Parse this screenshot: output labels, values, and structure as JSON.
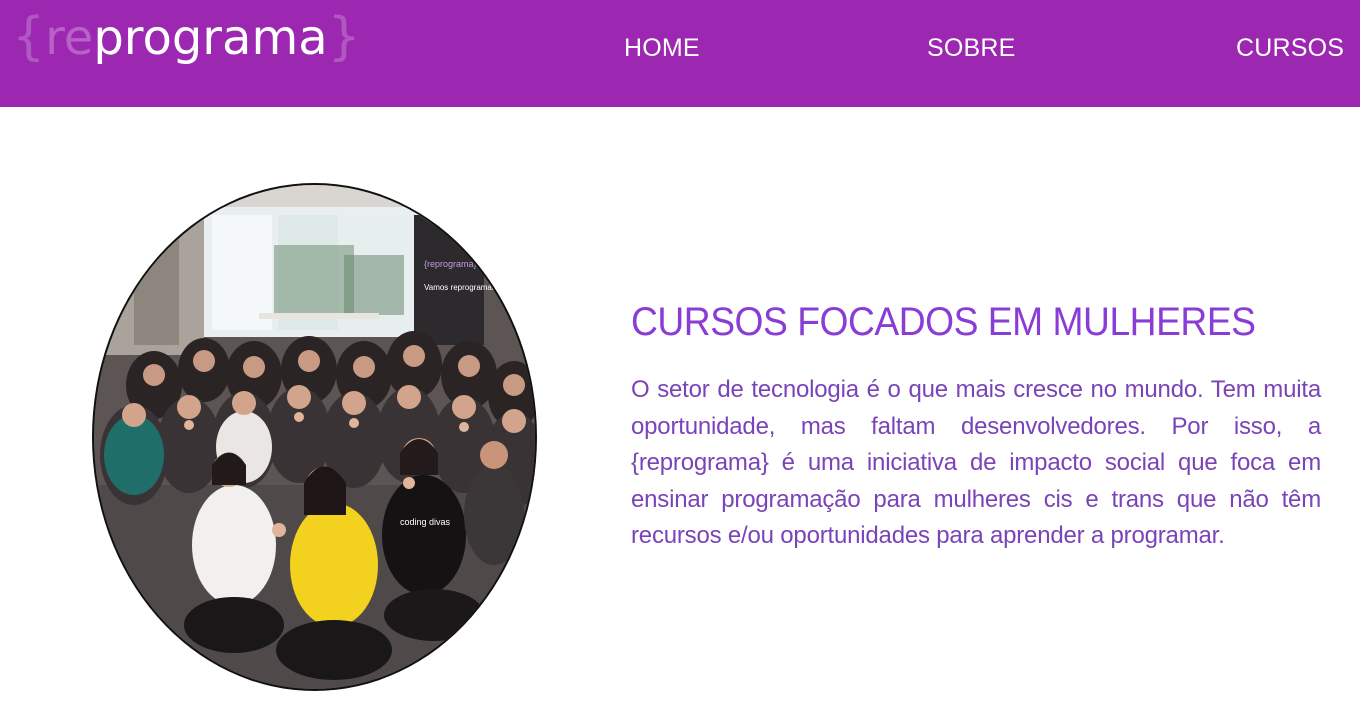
{
  "header": {
    "logo": {
      "open_brace": "{",
      "prefix": "re",
      "word": "programa",
      "close_brace": "}"
    },
    "nav": [
      {
        "label": "HOME"
      },
      {
        "label": "SOBRE"
      },
      {
        "label": "CURSOS"
      }
    ]
  },
  "main": {
    "photo": {
      "banner_brand": "{reprograma}",
      "banner_text": "Vamos reprogramar o mundo",
      "shirt_text": "coding divas"
    },
    "title": "CURSOS FOCADOS EM MULHERES",
    "paragraph": "O setor de tecnologia é o que mais cresce no mundo. Tem muita oportunidade, mas faltam desenvolvedores. Por isso, a {reprograma} é uma iniciativa de impacto social que foca em ensinar programação para mulheres cis e trans que não têm recursos e/ou oportunidades para aprender a programar."
  },
  "colors": {
    "header_bg": "#9c27b0",
    "title": "#8a3cd6",
    "paragraph": "#7a44b8"
  }
}
